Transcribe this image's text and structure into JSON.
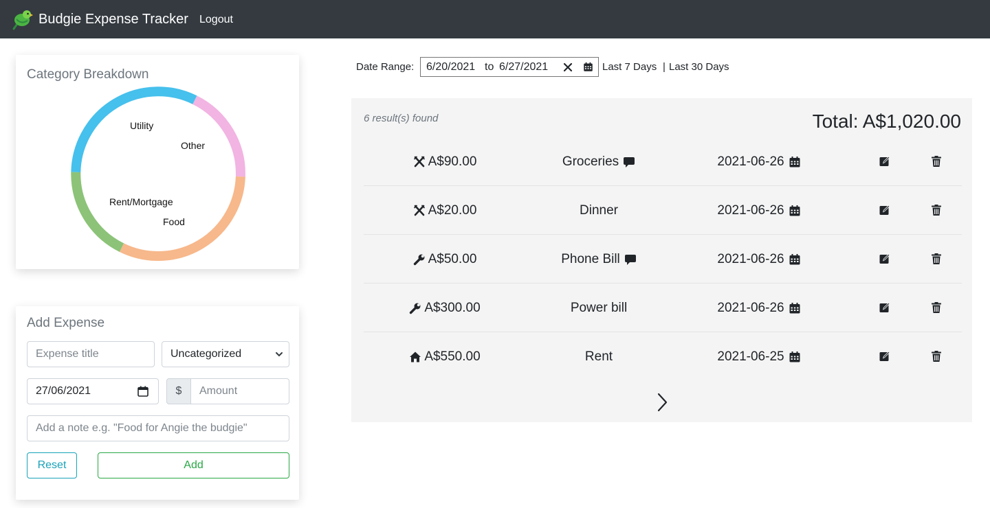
{
  "navbar": {
    "brand": "Budgie Expense Tracker",
    "logout": "Logout"
  },
  "breakdown": {
    "title": "Category Breakdown",
    "segments": [
      {
        "label": "Utility",
        "color": "#46c0ec"
      },
      {
        "label": "Other",
        "color": "#f2b4e2"
      },
      {
        "label": "Food",
        "color": "#f7b88b"
      },
      {
        "label": "Rent/Mortgage",
        "color": "#8cc378"
      }
    ]
  },
  "add_expense": {
    "title": "Add Expense",
    "title_placeholder": "Expense title",
    "category_selected": "Uncategorized",
    "date_value": "27/06/2021",
    "currency_symbol": "$",
    "amount_placeholder": "Amount",
    "note_placeholder": "Add a note e.g. \"Food for Angie the budgie\"",
    "reset_label": "Reset",
    "add_label": "Add"
  },
  "date_range": {
    "label": "Date Range:",
    "from": "6/20/2021",
    "to_word": "to",
    "to": "6/27/2021",
    "last7": "Last 7 Days",
    "separator": "|",
    "last30": "Last 30 Days"
  },
  "results": {
    "count": "6 result(s) found",
    "total": "Total: A$1,020.00",
    "rows": [
      {
        "category_icon": "utensils-icon",
        "amount": "A$90.00",
        "title": "Groceries",
        "has_note": true,
        "date": "2021-06-26"
      },
      {
        "category_icon": "utensils-icon",
        "amount": "A$20.00",
        "title": "Dinner",
        "has_note": false,
        "date": "2021-06-26"
      },
      {
        "category_icon": "wrench-icon",
        "amount": "A$50.00",
        "title": "Phone Bill",
        "has_note": true,
        "date": "2021-06-26"
      },
      {
        "category_icon": "wrench-icon",
        "amount": "A$300.00",
        "title": "Power bill",
        "has_note": false,
        "date": "2021-06-26"
      },
      {
        "category_icon": "home-icon",
        "amount": "A$550.00",
        "title": "Rent",
        "has_note": false,
        "date": "2021-06-25"
      }
    ]
  }
}
